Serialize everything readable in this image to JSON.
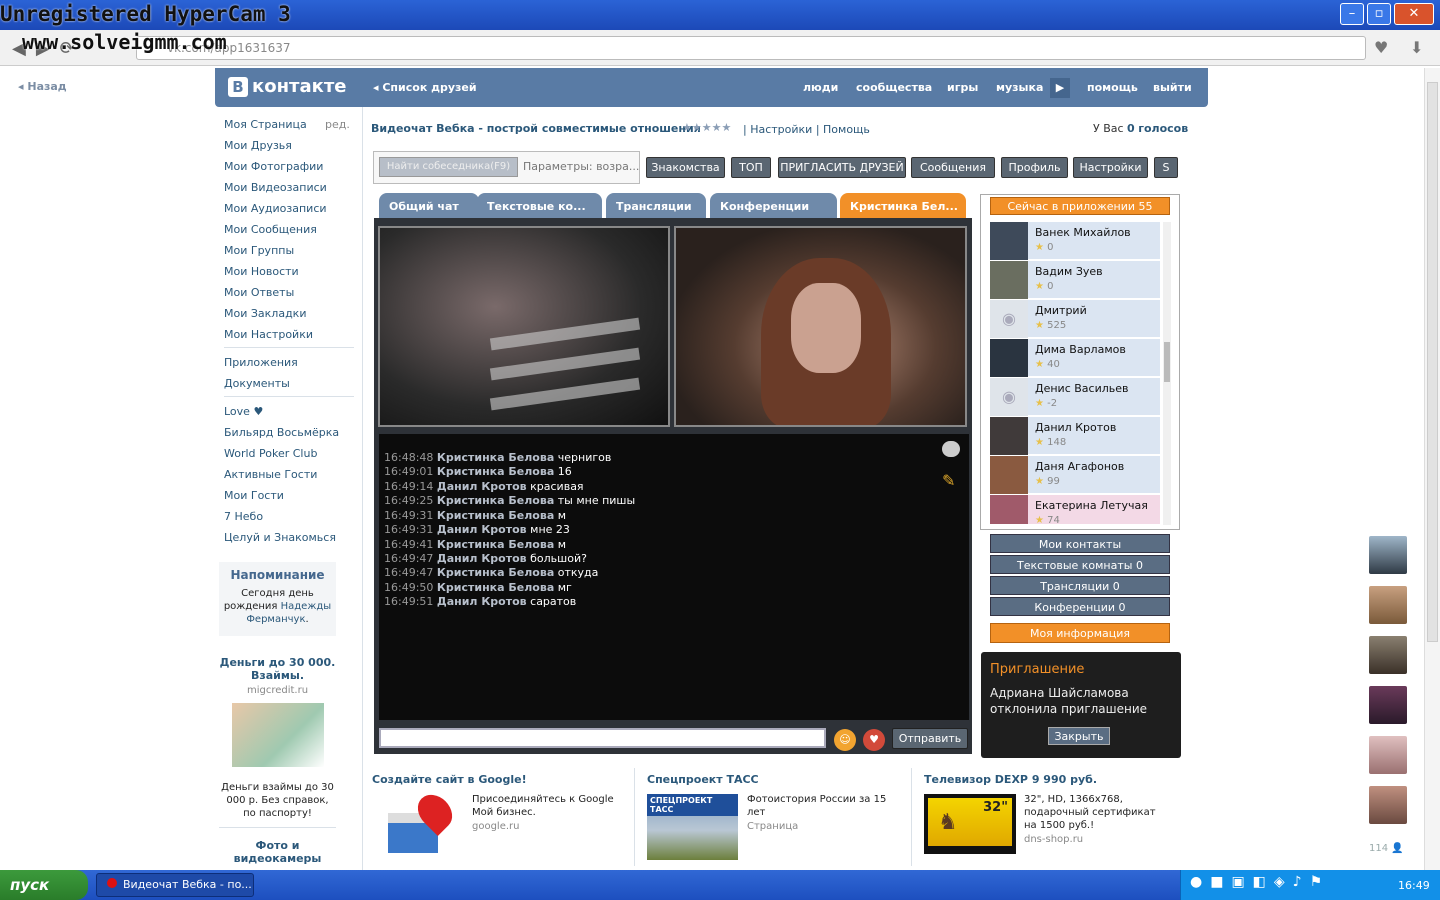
{
  "watermark": {
    "line1": "Unregistered HyperCam 3",
    "line2": "www.solveigmm.com"
  },
  "browser": {
    "url": "vk.com/app1631637",
    "tab_title": "Видеочат Вебка - по..."
  },
  "nav": {
    "back": "Назад"
  },
  "header": {
    "logo": "контакте",
    "logo_letter": "В",
    "friends_list": "Список друзей",
    "links": [
      "люди",
      "сообщества",
      "игры",
      "музыка",
      "помощь",
      "выйти"
    ]
  },
  "sidebar": {
    "edit": "ред.",
    "items": [
      "Моя Страница",
      "Мои Друзья",
      "Мои Фотографии",
      "Мои Видеозаписи",
      "Мои Аудиозаписи",
      "Мои Сообщения",
      "Мои Группы",
      "Мои Новости",
      "Мои Ответы",
      "Мои Закладки",
      "Мои Настройки"
    ],
    "items2": [
      "Приложения",
      "Документы"
    ],
    "apps": [
      "Love ♥",
      "Бильярд Восьмёрка",
      "World Poker Club",
      "Активные Гости",
      "Мои Гости",
      "7 Небо",
      "Целуй и Знакомься"
    ],
    "reminder": {
      "title": "Напоминание",
      "text_a": "Сегодня день рождения",
      "text_b": "Надежды Ферманчук",
      "text_c": "."
    },
    "ad1": {
      "title": "Деньги до 30 000. Взаймы.",
      "domain": "migcredit.ru",
      "text": "Деньги взаймы до 30 000 р. Без справок, по паспорту!"
    },
    "ad2": {
      "title": "Фото и видеокамеры"
    }
  },
  "app": {
    "title": "Видеочат Вебка - построй совместимые отношения",
    "stars": "★★★★★",
    "settings": "Настройки",
    "help": "Помощь",
    "votes_prefix": "У Вас",
    "votes_count": "0",
    "votes_suffix": "голосов",
    "find_button": "Найти собеседника(F9)",
    "params": "Параметры: возра...",
    "toolbar": [
      "Знакомства",
      "ТОП",
      "ПРИГЛАСИТЬ ДРУЗЕЙ",
      "Сообщения",
      "Профиль",
      "Настройки",
      "S"
    ],
    "tabs": [
      "Общий чат",
      "Текстовые ко...",
      "Трансляции",
      "Конференции",
      "Кристинка Бел..."
    ],
    "tab_close": "×",
    "messages": [
      {
        "time": "16:48:48",
        "name": "Кристинка Белова",
        "text": "чернигов"
      },
      {
        "time": "16:49:01",
        "name": "Кристинка Белова",
        "text": "16"
      },
      {
        "time": "16:49:14",
        "name": "Данил Кротов",
        "text": "красивая"
      },
      {
        "time": "16:49:25",
        "name": "Кристинка Белова",
        "text": "ты мне пишы"
      },
      {
        "time": "16:49:31",
        "name": "Кристинка Белова",
        "text": "м"
      },
      {
        "time": "16:49:31",
        "name": "Данил Кротов",
        "text": "мне 23"
      },
      {
        "time": "16:49:41",
        "name": "Кристинка Белова",
        "text": "м"
      },
      {
        "time": "16:49:47",
        "name": "Данил Кротов",
        "text": "большой?"
      },
      {
        "time": "16:49:47",
        "name": "Кристинка Белова",
        "text": "откуда"
      },
      {
        "time": "16:49:50",
        "name": "Кристинка Белова",
        "text": "мг"
      },
      {
        "time": "16:49:51",
        "name": "Данил Кротов",
        "text": "саратов"
      }
    ],
    "send": "Отправить",
    "online": "Сейчас в приложении 55",
    "users": [
      {
        "name": "Ванек Михайлов",
        "rating": "0"
      },
      {
        "name": "Вадим Зуев",
        "rating": "0"
      },
      {
        "name": "Дмитрий",
        "rating": "525"
      },
      {
        "name": "Дима Варламов",
        "rating": "40"
      },
      {
        "name": "Денис Васильев",
        "rating": "-2"
      },
      {
        "name": "Данил Кротов",
        "rating": "148"
      },
      {
        "name": "Даня Агафонов",
        "rating": "99"
      },
      {
        "name": "Екатерина Летучая",
        "rating": "74"
      }
    ],
    "accordion": [
      "Мои контакты",
      "Текстовые комнаты 0",
      "Трансляции 0",
      "Конференции 0"
    ],
    "my_info": "Моя информация",
    "invite": {
      "title": "Приглашение",
      "text": "Адриана Шайсламова отклонила приглашение",
      "close": "Закрыть"
    }
  },
  "ads": [
    {
      "title": "Создайте сайт в Google!",
      "text": "Присоединяйтесь к Google Мой бизнес.",
      "domain": "google.ru"
    },
    {
      "title": "Спецпроект ТАСС",
      "badge": "СПЕЦПРОЕКТ ТАСС",
      "text": "Фотоистория России за 15 лет",
      "domain": "Страница"
    },
    {
      "title": "Телевизор DEXP 9 990 руб.",
      "text": "32\", HD, 1366x768, подарочный сертификат на 1500 руб.!",
      "domain": "dns-shop.ru",
      "badge": "32\""
    }
  ],
  "right_count": "114",
  "taskbar": {
    "start": "пуск",
    "clock": "16:49"
  },
  "colors": {
    "vk_blue": "#597ba5",
    "orange": "#f29028",
    "link": "#2b587a"
  }
}
